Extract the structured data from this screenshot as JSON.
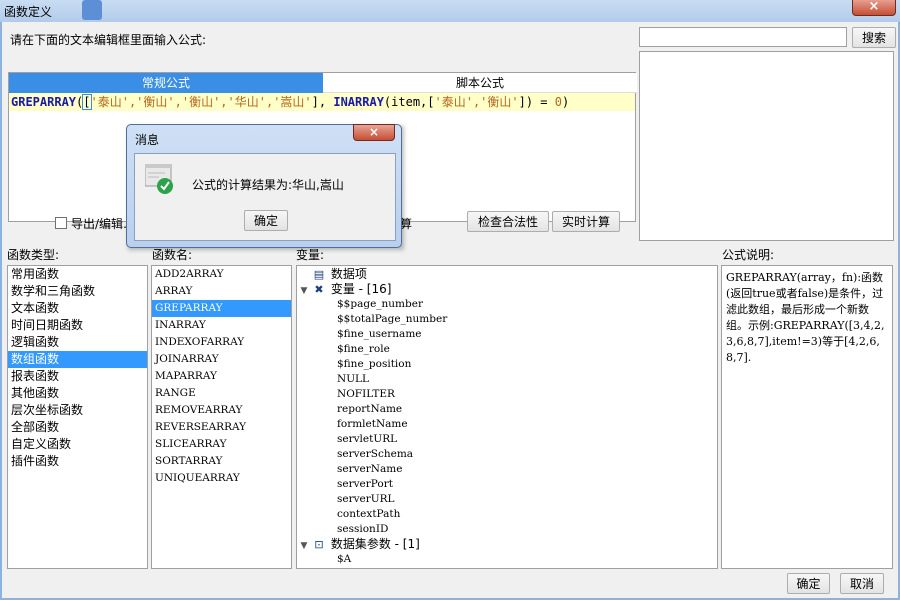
{
  "window": {
    "title": "函数定义",
    "close_glyph": "×"
  },
  "editor": {
    "prompt": "请在下面的文本编辑框里面输入公式:",
    "tabs": [
      "常规公式",
      "脚本公式"
    ],
    "formula": {
      "fn1": "GREPARRAY",
      "p1": "(",
      "caret": "[",
      "s1": "'泰山','衡山','衡山','华山','嵩山'",
      "p2": "], ",
      "fn2": "INARRAY",
      "p3": "(item,[",
      "s2": "'泰山','衡山'",
      "p4": "]) = ",
      "num": "0",
      "p5": ")"
    }
  },
  "search": {
    "button": "搜索",
    "value": ""
  },
  "options": {
    "export_label": "导出/编辑…",
    "calc_label": "算",
    "check_button": "检查合法性",
    "realtime_button": "实时计算"
  },
  "headers": {
    "category": "函数类型:",
    "function": "函数名:",
    "variable": "变量:",
    "description": "公式说明:"
  },
  "categories": [
    "常用函数",
    "数学和三角函数",
    "文本函数",
    "时间日期函数",
    "逻辑函数",
    "数组函数",
    "报表函数",
    "其他函数",
    "层次坐标函数",
    "全部函数",
    "自定义函数",
    "插件函数"
  ],
  "selected_category": "数组函数",
  "functions": [
    "ADD2ARRAY",
    "ARRAY",
    "GREPARRAY",
    "INARRAY",
    "INDEXOFARRAY",
    "JOINARRAY",
    "MAPARRAY",
    "RANGE",
    "REMOVEARRAY",
    "REVERSEARRAY",
    "SLICEARRAY",
    "SORTARRAY",
    "UNIQUEARRAY"
  ],
  "selected_function": "GREPARRAY",
  "variables": {
    "data_item": "数据项",
    "var_group": "变量 - [16]",
    "vars": [
      "$$page_number",
      "$$totalPage_number",
      "$fine_username",
      "$fine_role",
      "$fine_position",
      "NULL",
      "NOFILTER",
      "reportName",
      "formletName",
      "servletURL",
      "serverSchema",
      "serverName",
      "serverPort",
      "serverURL",
      "contextPath",
      "sessionID"
    ],
    "dataset_group": "数据集参数 - [1]",
    "dataset_vars": [
      "$A"
    ]
  },
  "description": "GREPARRAY(array，fn):函数(返回true或者false)是条件，过滤此数组，最后形成一个新数组。示例:GREPARRAY([3,4,2,3,6,8,7],item!=3)等于[4,2,6,8,7].",
  "footer": {
    "ok": "确定",
    "cancel": "取消"
  },
  "message": {
    "title": "消息",
    "text": "公式的计算结果为:华山,嵩山",
    "ok": "确定",
    "close_glyph": "×"
  },
  "colors": {
    "accent": "#3399ff",
    "tab_active": "#3a8ee6",
    "formula_bg": "#ffffc8",
    "check_green": "#2ca24a"
  }
}
